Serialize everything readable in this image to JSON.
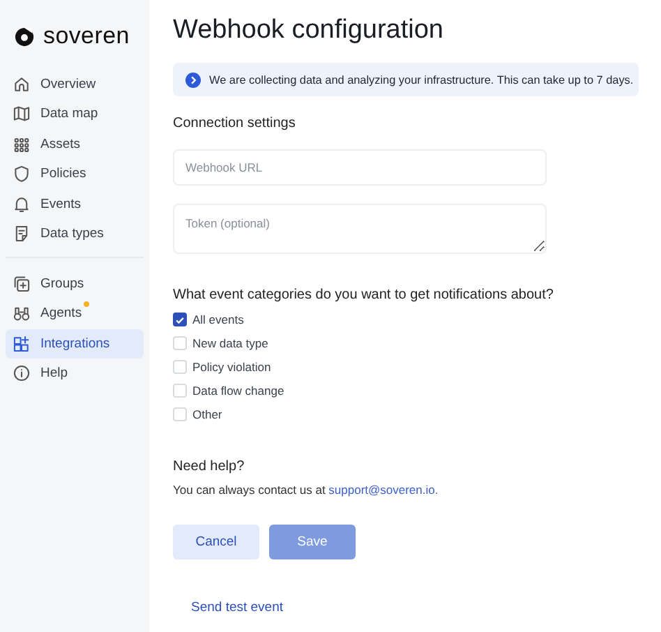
{
  "sidebar": {
    "logo": "soveren",
    "groups": [
      {
        "items": [
          {
            "label": "Overview",
            "selected": false,
            "notification": false
          },
          {
            "label": "Data map",
            "selected": false,
            "notification": false
          },
          {
            "label": "Assets",
            "selected": false,
            "notification": false
          },
          {
            "label": "Policies",
            "selected": false,
            "notification": false
          },
          {
            "label": "Events",
            "selected": false,
            "notification": false
          },
          {
            "label": "Data types",
            "selected": false,
            "notification": false
          }
        ]
      },
      {
        "items": [
          {
            "label": "Groups",
            "selected": false,
            "notification": false
          },
          {
            "label": "Agents",
            "selected": false,
            "notification": true
          },
          {
            "label": "Integrations",
            "selected": true,
            "notification": false
          },
          {
            "label": "Help",
            "selected": false,
            "notification": false
          }
        ]
      }
    ]
  },
  "page_title": "Webhook configuration",
  "info_banner": "We are collecting data and analyzing your infrastructure. This can take up to 7 days.",
  "connection_settings": {
    "heading": "Connection settings",
    "fields": [
      {
        "kind": "input",
        "placeholder": "Webhook URL"
      },
      {
        "kind": "textarea",
        "placeholder": "Token (optional)"
      }
    ]
  },
  "event_categories": {
    "question": "What event categories do you want to get notifications about?",
    "options": [
      {
        "label": "All events",
        "checked": true
      },
      {
        "label": "New data type",
        "checked": false
      },
      {
        "label": "Policy violation",
        "checked": false
      },
      {
        "label": "Data flow change",
        "checked": false
      },
      {
        "label": "Other",
        "checked": false
      }
    ]
  },
  "help": {
    "heading": "Need help?",
    "text": "You can always contact us at",
    "link": "support@soveren.io."
  },
  "buttons": [
    {
      "label": "Cancel",
      "kind": "secondary",
      "disabled": false
    },
    {
      "label": "Save",
      "kind": "primary",
      "disabled": true
    }
  ],
  "test_link": "Send test event"
}
